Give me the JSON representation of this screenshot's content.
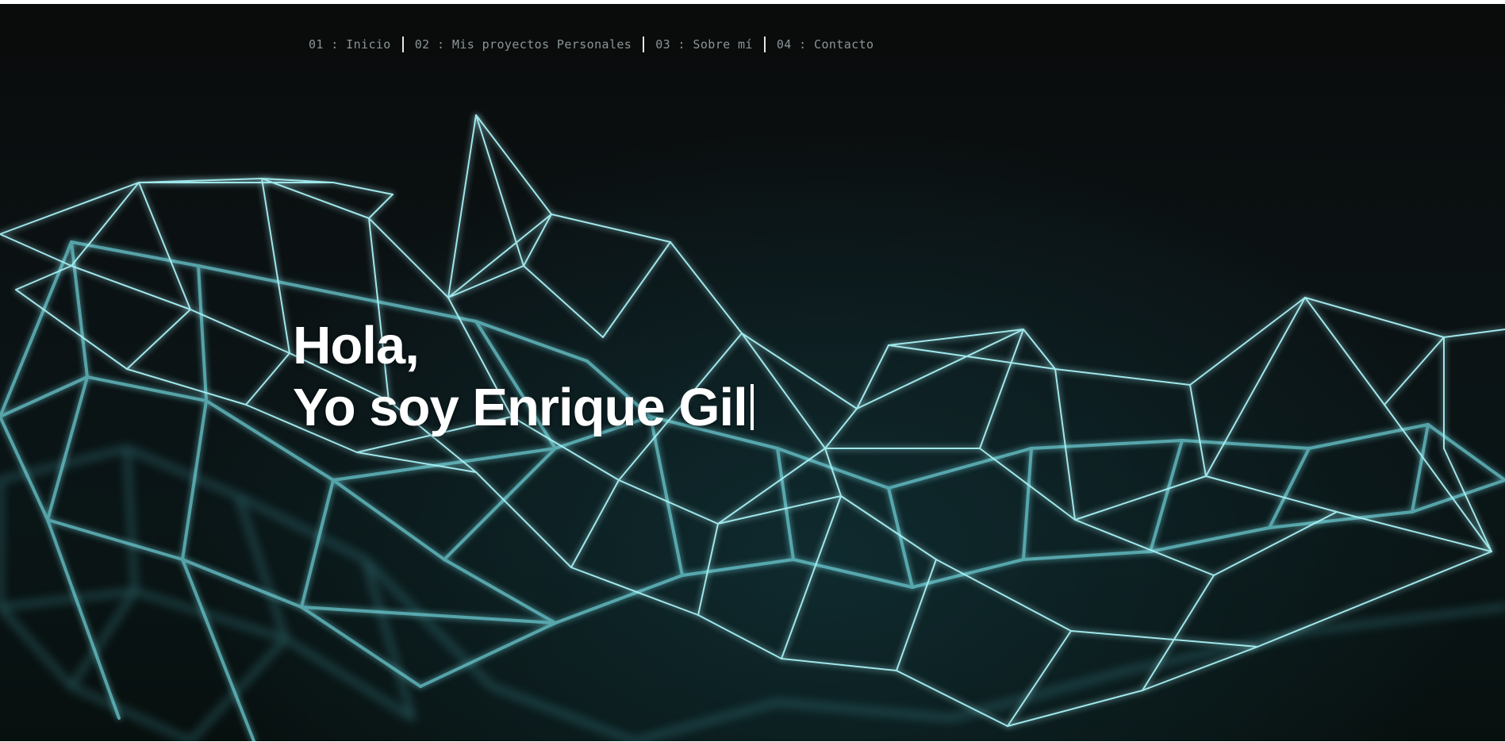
{
  "nav": {
    "items": [
      {
        "label": "01 : Inicio"
      },
      {
        "label": "02 : Mis proyectos Personales"
      },
      {
        "label": "03 : Sobre mí"
      },
      {
        "label": "04 : Contacto"
      }
    ]
  },
  "hero": {
    "greeting": "Hola,",
    "intro": "Yo soy Enrique Gil",
    "background_image": "glowing-cyan-wireframe-mesh",
    "accent_color": "#7fe3ea"
  }
}
